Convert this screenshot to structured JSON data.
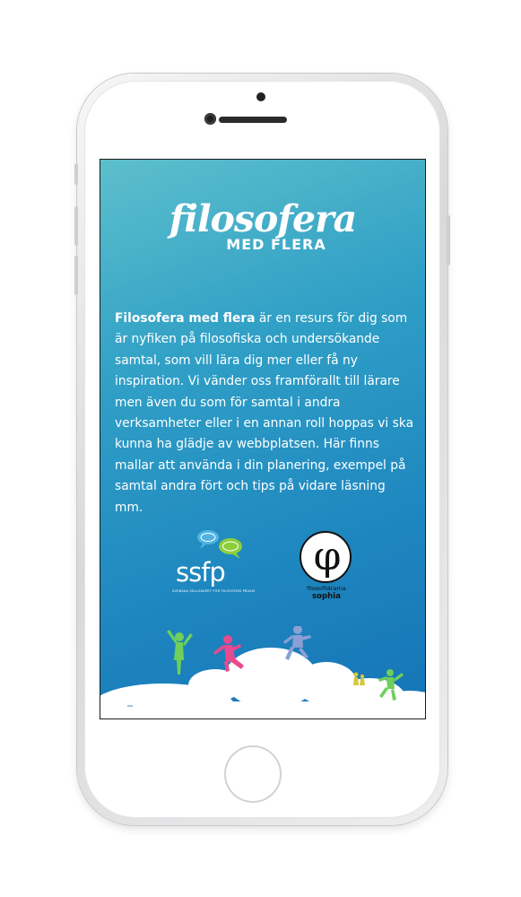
{
  "app": {
    "logo_script": "filosofera",
    "logo_sub": "MED FLERA"
  },
  "intro": {
    "lead": "Filosofera med flera",
    "text": " är en resurs för dig som är nyfiken på filosofiska och undersökande samtal, som vill lära dig mer eller få ny inspiration. Vi vänder oss framförallt till lärare men även du som för samtal i andra verksamheter eller i en annan roll hoppas vi ska kunna ha glädje av webbplatsen. Här finns mallar att använda i din planering, exempel på samtal andra fört och tips på vidare läsning mm."
  },
  "partners": {
    "ssfp": {
      "name": "ssfp",
      "tagline": "SVENSKA SÄLLSKAPET FÖR FILOSOFISK PRAXIS"
    },
    "sophia": {
      "symbol": "φ",
      "line1": "filosofilärarna",
      "line2": "sophia"
    }
  },
  "colors": {
    "screen_top": "#5dbfcc",
    "screen_bottom": "#1574b6",
    "cloud": "#ffffff",
    "figure_green": "#6fcf5a",
    "figure_pink": "#e8498f",
    "figure_blue": "#5a8fd6",
    "bubble_blue": "#4fb4e3",
    "bubble_green": "#8ccf3a"
  }
}
